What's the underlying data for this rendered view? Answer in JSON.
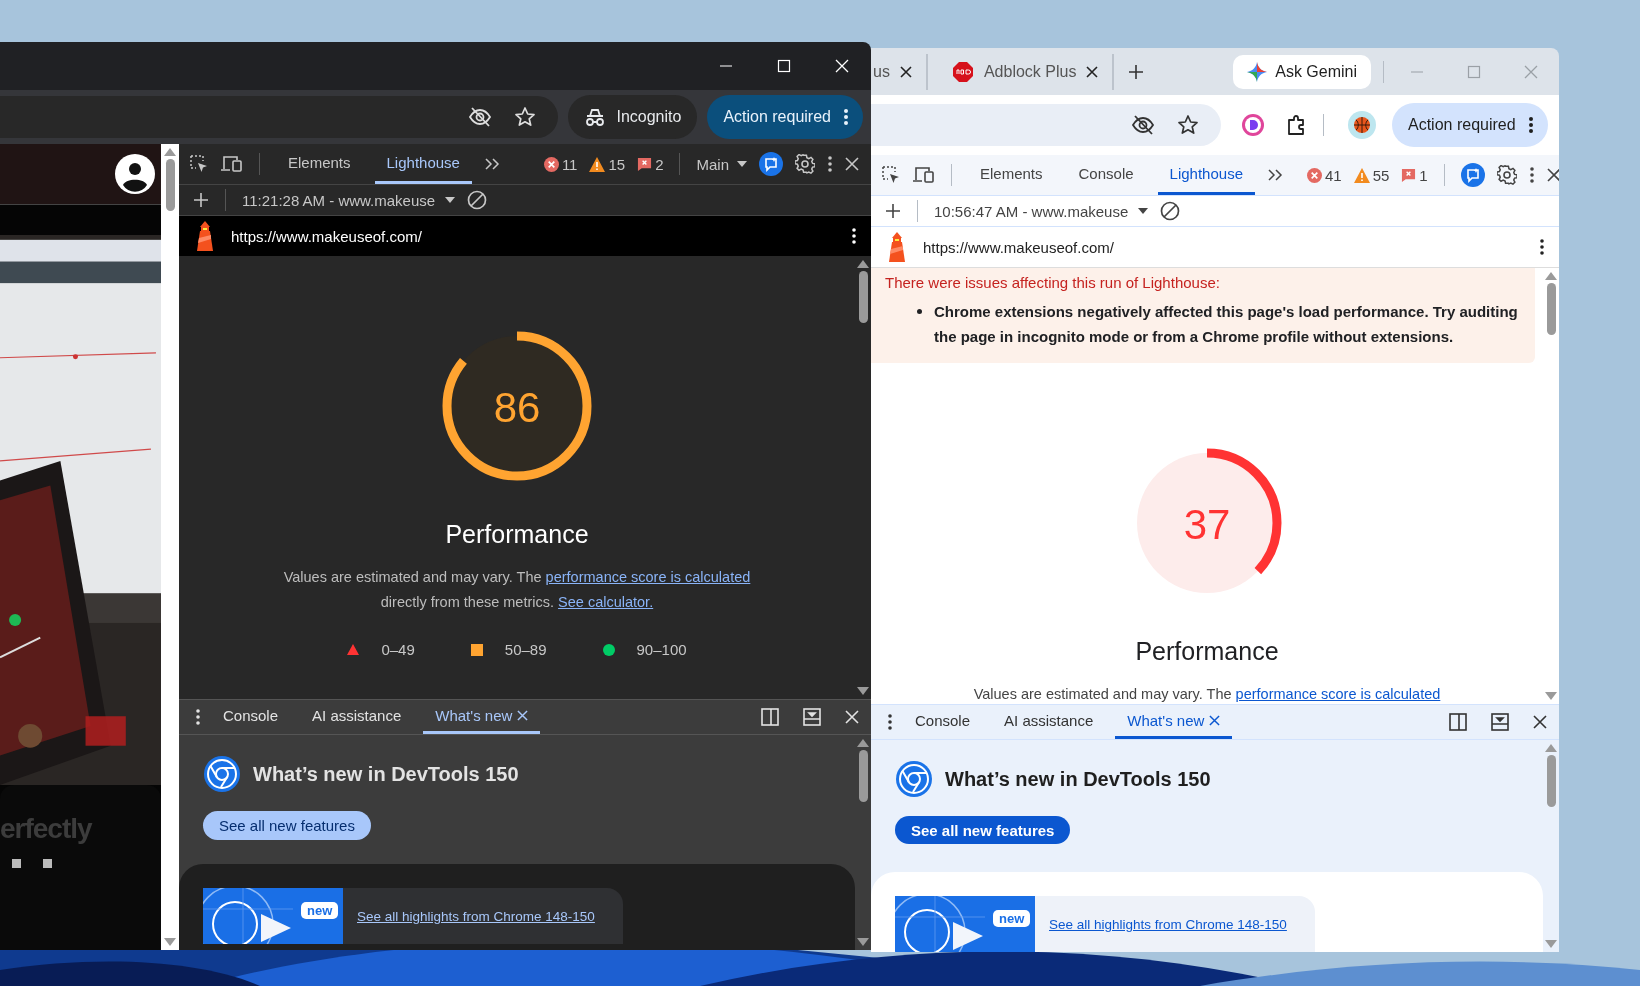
{
  "windows": [
    {
      "kind": "incognito",
      "web_page": {
        "headline": "erfectly"
      },
      "incognito_label": "Incognito",
      "action_button": "Action required",
      "devtools": {
        "tabs": [
          {
            "label": "Elements",
            "selected": false
          },
          {
            "label": "Lighthouse",
            "selected": true
          }
        ],
        "errors": "11",
        "warnings": "15",
        "issues": "2",
        "target": "Main",
        "report": "11:21:28 AM - www.makeuse",
        "url": "https://www.makeuseof.com/",
        "score": {
          "value": "86",
          "level": 0.86,
          "title": "Performance"
        },
        "description": {
          "text": "Values are estimated and may vary. The ",
          "link": "performance score is calculated",
          "text_2": "directly from these metrics.",
          "link_2": "See calculator."
        },
        "legend": [
          {
            "kind": "fail",
            "label": "0–49"
          },
          {
            "kind": "average",
            "label": "50–89"
          },
          {
            "kind": "pass",
            "label": "90–100"
          }
        ],
        "drawer": {
          "tabs": [
            {
              "label": "Console",
              "selected": false,
              "closable": false
            },
            {
              "label": "AI assistance",
              "selected": false,
              "closable": false
            },
            {
              "label": "What's new",
              "selected": true,
              "closable": true
            }
          ],
          "heading": "What’s new in DevTools 150",
          "button": "See all new features",
          "badge": "new",
          "highlight_link": "See all highlights from Chrome 148-150"
        }
      }
    },
    {
      "kind": "regular",
      "tabs": [
        {
          "label": "us",
          "selected": false
        },
        {
          "label": "Adblock Plus",
          "selected": false
        }
      ],
      "gemini_button": "Ask Gemini",
      "action_button": "Action required",
      "devtools": {
        "tabs": [
          {
            "label": "Elements",
            "selected": false
          },
          {
            "label": "Console",
            "selected": false
          },
          {
            "label": "Lighthouse",
            "selected": true
          }
        ],
        "errors": "41",
        "warnings": "55",
        "issues": "1",
        "report": "10:56:47 AM - www.makeuse",
        "url": "https://www.makeuseof.com/",
        "warning": {
          "title": "There were issues affecting this run of Lighthouse:",
          "items": [
            "Chrome extensions negatively affected this page's load performance. Try auditing the page in incognito mode or from a Chrome profile without extensions."
          ]
        },
        "score": {
          "value": "37",
          "level": 0.37,
          "title": "Performance"
        },
        "description": {
          "text": "Values are estimated and may vary. The ",
          "link": "performance score is calculated"
        },
        "drawer": {
          "tabs": [
            {
              "label": "Console",
              "selected": false,
              "closable": false
            },
            {
              "label": "AI assistance",
              "selected": false,
              "closable": false
            },
            {
              "label": "What's new",
              "selected": true,
              "closable": true
            }
          ],
          "heading": "What’s new in DevTools 150",
          "button": "See all new features",
          "badge": "new",
          "highlight_link": "See all highlights from Chrome 148-150"
        }
      }
    }
  ]
}
